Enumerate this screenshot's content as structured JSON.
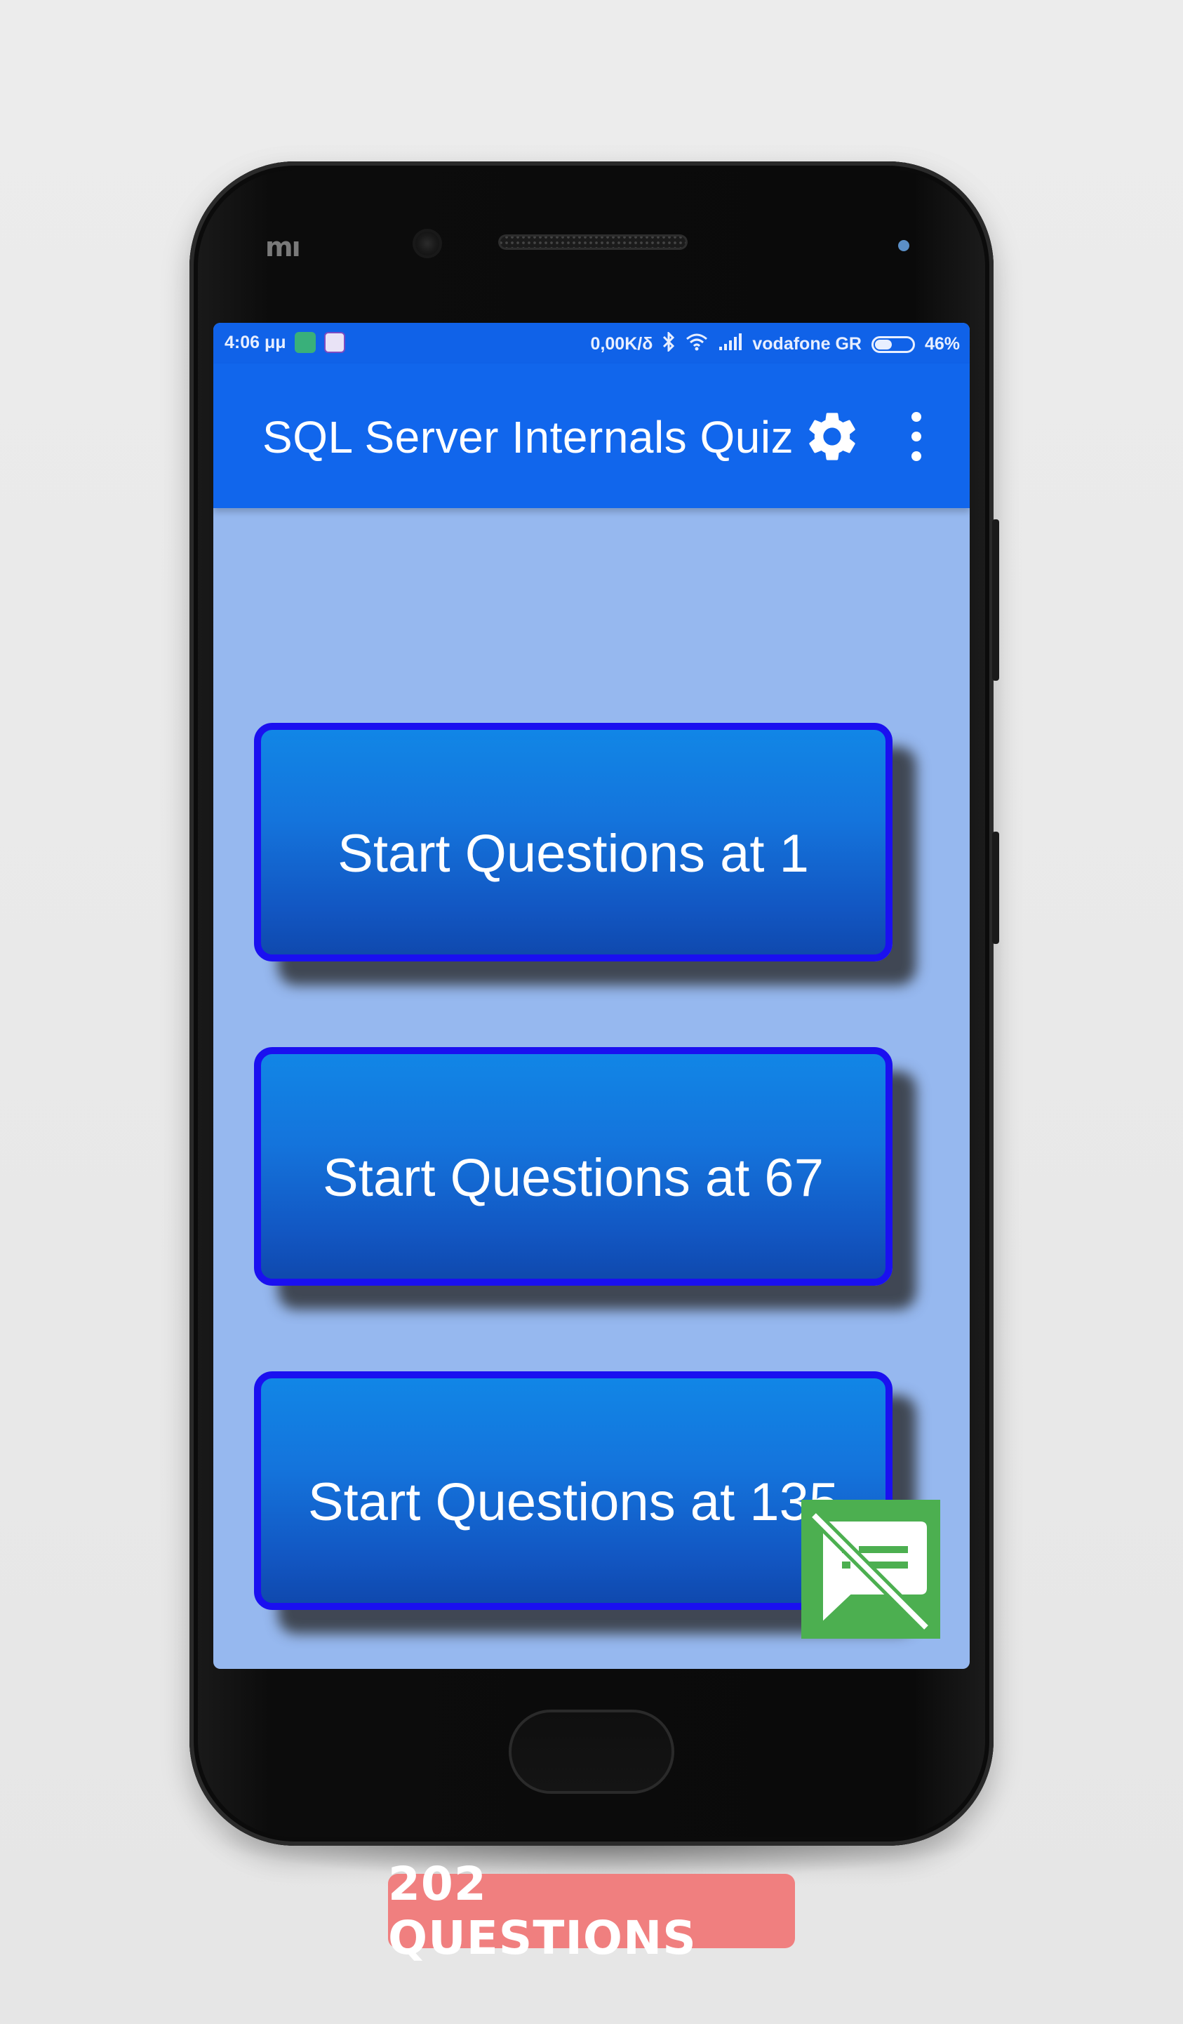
{
  "device": {
    "brand_logo": "mı"
  },
  "status_bar": {
    "time": "4:06 μμ",
    "data_rate": "0,00K/δ",
    "carrier": "vodafone GR",
    "battery_percent": "46%",
    "battery_level": 0.46,
    "icons": [
      "shield-icon",
      "viber-icon",
      "bluetooth-icon",
      "wifi-icon",
      "signal-icon",
      "battery-icon"
    ]
  },
  "app_bar": {
    "title": "SQL Server Internals Quiz",
    "actions": [
      "gear-icon",
      "more-vertical-icon"
    ]
  },
  "main": {
    "buttons": [
      {
        "label": "Start Questions at 1"
      },
      {
        "label": "Start Questions at 67"
      },
      {
        "label": "Start Questions at 135"
      }
    ],
    "ad_icon": "no-ads-icon"
  },
  "footer": {
    "badge_text": "202 QUESTIONS"
  },
  "colors": {
    "app_bar": "#1166ec",
    "screen_background": "#96b8ef",
    "button_border": "#1a10f0",
    "ad_badge": "#4caf50",
    "footer_badge": "#f07f7f"
  }
}
